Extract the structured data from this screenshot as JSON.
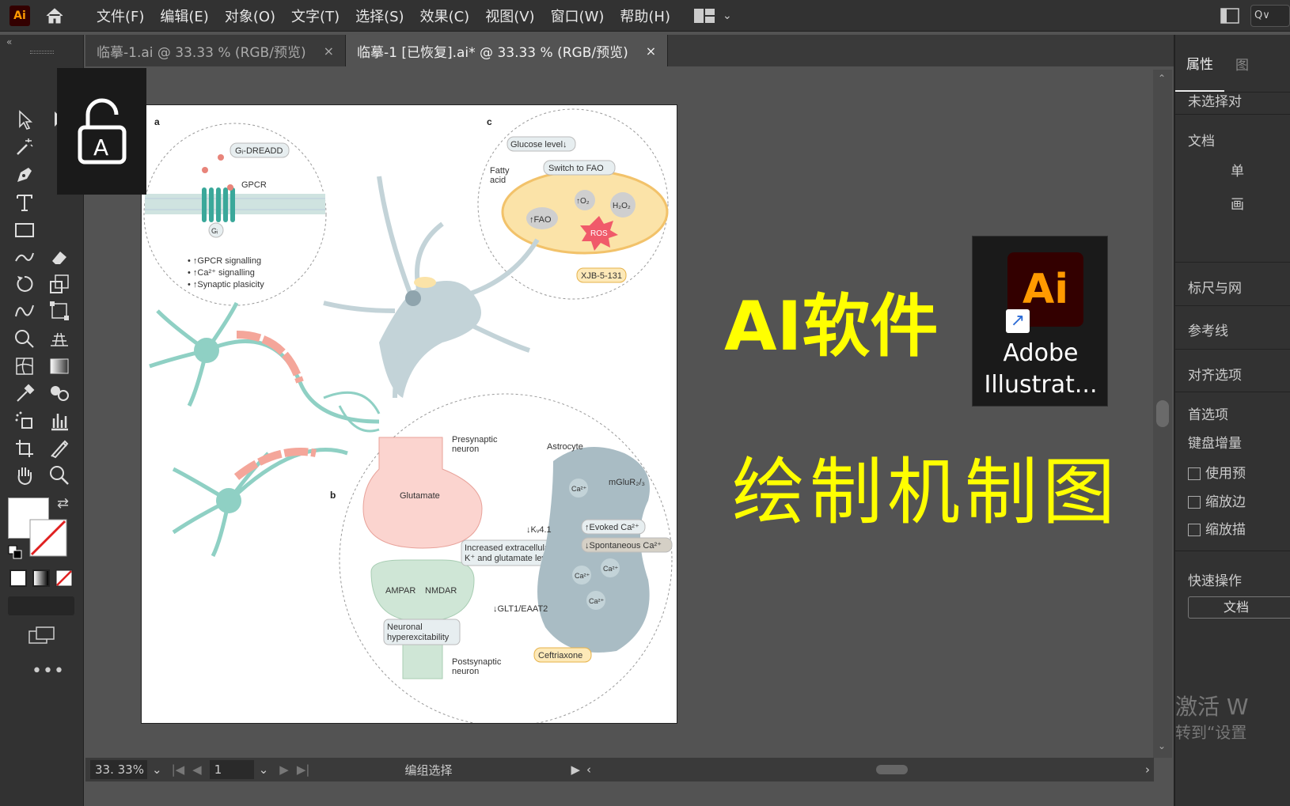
{
  "app": {
    "logo": "Ai"
  },
  "menu": [
    "文件(F)",
    "编辑(E)",
    "对象(O)",
    "文字(T)",
    "选择(S)",
    "效果(C)",
    "视图(V)",
    "窗口(W)",
    "帮助(H)"
  ],
  "search": {
    "icon": "search-icon",
    "text": "Q∨"
  },
  "tabs": [
    {
      "label": "临摹-1.ai @ 33.33 % (RGB/预览)",
      "close": "×"
    },
    {
      "label": "临摹-1 [已恢复].ai* @ 33.33 % (RGB/预览)",
      "close": "×"
    }
  ],
  "right_panel": {
    "tabs": [
      "属性",
      "图"
    ],
    "no_selection": "未选择对",
    "doc": "文档",
    "unit": "单",
    "artboard": "画",
    "rulers": "标尺与网",
    "guides": "参考线",
    "align": "对齐选项",
    "prefs": "首选项",
    "keyboard": "键盘增量",
    "checks": [
      "使用预",
      "缩放边",
      "缩放描"
    ],
    "quick": "快速操作",
    "doc_btn": "文档"
  },
  "watermark": {
    "line1": "激活 W",
    "line2": "转到“设置"
  },
  "status": {
    "zoom": "33. 33%",
    "page": "1",
    "tool": "编组选择"
  },
  "overlay": {
    "title": "AI软件",
    "subtitle": "绘制机制图"
  },
  "desktop_icon": {
    "badge": "Ai",
    "label1": "Adobe",
    "label2": "Illustrat..."
  },
  "figure": {
    "panel_a": "a",
    "panel_b": "b",
    "panel_c": "c",
    "dreadd": "Gᵢ-DREADD",
    "gpcr": "GPCR",
    "gi": "Gᵢ",
    "sig1": "• ↑GPCR signalling",
    "sig2": "• ↑Ca²⁺ signalling",
    "sig3": "• ↑Synaptic plasicity",
    "glucose": "Glucose level↓",
    "switch": "Switch to FAO",
    "fatty1": "Fatty",
    "fatty2": "acid",
    "fao": "↑FAO",
    "o2": "↑O₂",
    "h2o2": "H₂O₂",
    "ros": "ROS",
    "xjb": "XJB-5-131",
    "pre1": "Presynaptic",
    "pre2": "neuron",
    "glutamate": "Glutamate",
    "astro": "Astrocyte",
    "mglur": "mGluR₂/₃",
    "kv": "↓Kᵥ4.1",
    "evoked": "↑Evoked Ca²⁺",
    "spont": "↓Spontaneous Ca²⁺",
    "inc1": "Increased extracellular",
    "inc2": "K⁺ and glutamate level",
    "ampar": "AMPAR",
    "nmdar": "NMDAR",
    "glt": "↓GLT1/EAAT2",
    "neu1": "Neuronal",
    "neu2": "hyperexcitability",
    "cef": "Ceftriaxone",
    "post1": "Postsynaptic",
    "post2": "neuron",
    "ca": "Ca²⁺"
  }
}
